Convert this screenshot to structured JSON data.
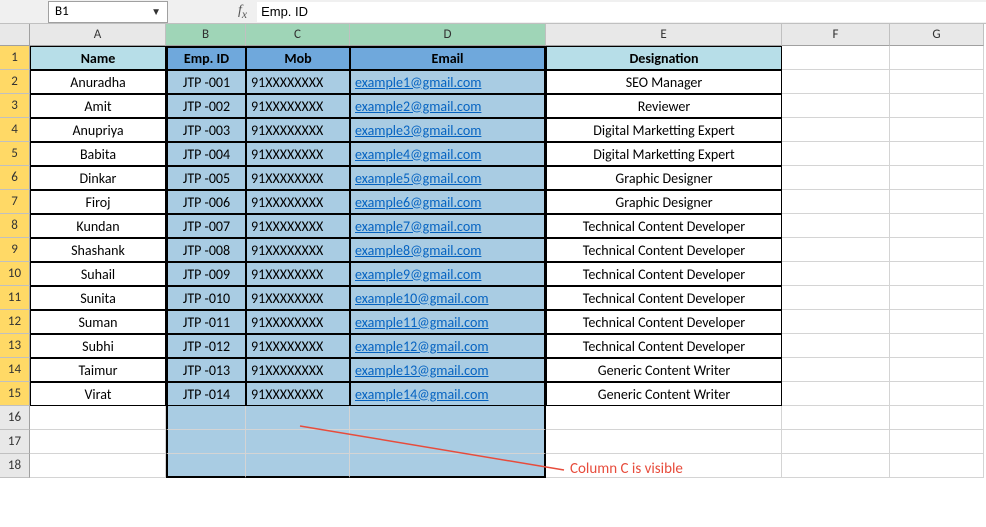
{
  "name_box_value": "B1",
  "formula_value": "Emp. ID",
  "column_letters": [
    "A",
    "B",
    "C",
    "D",
    "E",
    "F",
    "G"
  ],
  "row_numbers": [
    1,
    2,
    3,
    4,
    5,
    6,
    7,
    8,
    9,
    10,
    11,
    12,
    13,
    14,
    15,
    16,
    17,
    18
  ],
  "headers": {
    "A": "Name",
    "B": "Emp. ID",
    "C": "Mob",
    "D": "Email",
    "E": "Designation"
  },
  "selected_columns": [
    "B",
    "C",
    "D"
  ],
  "data_row_count": 14,
  "rows": [
    {
      "name": "Anuradha",
      "emp": "JTP -001",
      "mob": "91XXXXXXXX",
      "email": "example1@gmail.com",
      "desig": "SEO Manager"
    },
    {
      "name": "Amit",
      "emp": "JTP -002",
      "mob": "91XXXXXXXX",
      "email": "example2@gmail.com",
      "desig": "Reviewer"
    },
    {
      "name": "Anupriya",
      "emp": "JTP -003",
      "mob": "91XXXXXXXX",
      "email": "example3@gmail.com",
      "desig": "Digital Marketting Expert"
    },
    {
      "name": "Babita",
      "emp": "JTP -004",
      "mob": "91XXXXXXXX",
      "email": "example4@gmail.com",
      "desig": "Digital Marketting Expert"
    },
    {
      "name": "Dinkar",
      "emp": "JTP -005",
      "mob": "91XXXXXXXX",
      "email": "example5@gmail.com",
      "desig": "Graphic Designer"
    },
    {
      "name": "Firoj",
      "emp": "JTP -006",
      "mob": "91XXXXXXXX",
      "email": "example6@gmail.com",
      "desig": "Graphic Designer"
    },
    {
      "name": "Kundan",
      "emp": "JTP -007",
      "mob": "91XXXXXXXX",
      "email": "example7@gmail.com",
      "desig": "Technical Content Developer"
    },
    {
      "name": "Shashank",
      "emp": "JTP -008",
      "mob": "91XXXXXXXX",
      "email": "example8@gmail.com",
      "desig": "Technical Content Developer"
    },
    {
      "name": "Suhail",
      "emp": "JTP -009",
      "mob": "91XXXXXXXX",
      "email": "example9@gmail.com",
      "desig": "Technical Content Developer"
    },
    {
      "name": "Sunita",
      "emp": "JTP -010",
      "mob": "91XXXXXXXX",
      "email": "example10@gmail.com",
      "desig": "Technical Content Developer"
    },
    {
      "name": "Suman",
      "emp": "JTP -011",
      "mob": "91XXXXXXXX",
      "email": "example11@gmail.com",
      "desig": "Technical Content Developer"
    },
    {
      "name": "Subhi",
      "emp": "JTP -012",
      "mob": "91XXXXXXXX",
      "email": "example12@gmail.com",
      "desig": "Technical Content Developer"
    },
    {
      "name": "Taimur",
      "emp": "JTP -013",
      "mob": "91XXXXXXXX",
      "email": "example13@gmail.com",
      "desig": "Generic Content Writer"
    },
    {
      "name": "Virat",
      "emp": "JTP -014",
      "mob": "91XXXXXXXX",
      "email": "example14@gmail.com",
      "desig": "Generic Content Writer"
    }
  ],
  "annotation_text": "Column C is visible",
  "colors": {
    "selected_col_header": "#9fd5b7",
    "row_header_highlight": "#ffd966",
    "table_header_bg": "#b7dee8",
    "selected_cell_bg": "#a9cce3",
    "annotation": "#e74c3c"
  }
}
